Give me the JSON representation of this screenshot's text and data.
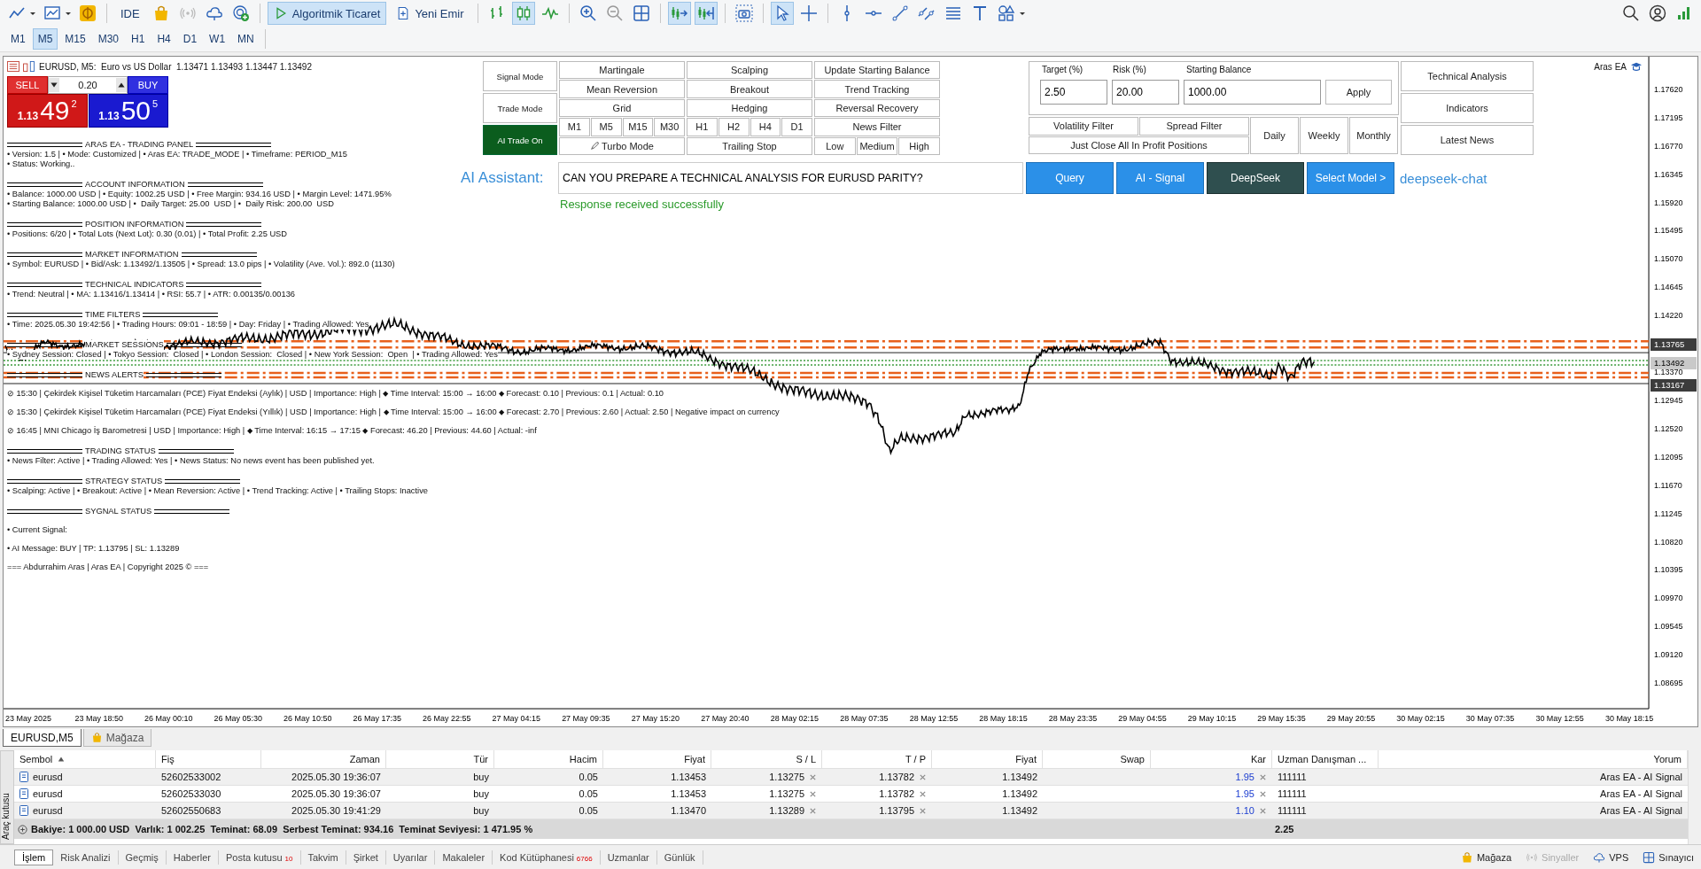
{
  "toolbar": {
    "ide": "IDE",
    "algo_trading": {
      "label": "Algoritmik Ticaret",
      "on": true
    },
    "new_order": "Yeni Emir",
    "signal": {
      "disabled": true
    },
    "chart_types": [
      {
        "selected": false
      },
      {
        "selected": true
      },
      {
        "selected": false
      }
    ],
    "zoom_out": {
      "disabled": true
    },
    "auto_scroll": {
      "on": true
    },
    "chart_shift": {
      "on": true
    },
    "tools": [
      {
        "selected": true
      },
      {
        "selected": false
      }
    ]
  },
  "timeframes": [
    {
      "label": "M1",
      "selected": false
    },
    {
      "label": "M5",
      "selected": true
    },
    {
      "label": "M15",
      "selected": false
    },
    {
      "label": "M30",
      "selected": false
    },
    {
      "label": "H1",
      "selected": false
    },
    {
      "label": "H4",
      "selected": false
    },
    {
      "label": "D1",
      "selected": false
    },
    {
      "label": "W1",
      "selected": false
    },
    {
      "label": "MN",
      "selected": false
    }
  ],
  "chart": {
    "title": "EURUSD, M5:  Euro vs US Dollar  1.13471 1.13493 1.13447 1.13492",
    "expert": "Aras EA",
    "one_click": {
      "sell": {
        "label": "SELL",
        "prefix": "1.13",
        "big": "49",
        "small": "2"
      },
      "lot": "0.20",
      "buy": {
        "label": "BUY",
        "prefix": "1.13",
        "big": "50",
        "small": "5"
      }
    },
    "price_axis": {
      "labels": [
        "1.17620",
        "1.17195",
        "1.16770",
        "1.16345",
        "1.15920",
        "1.15495",
        "1.15070",
        "1.14645",
        "1.14220",
        "1.13370",
        "1.12945",
        "1.12520",
        "1.12095",
        "1.11670",
        "1.11245",
        "1.10820",
        "1.10395",
        "1.09970",
        "1.09545",
        "1.09120",
        "1.08695"
      ],
      "tags": [
        {
          "text": "1.13765",
          "kind": "level"
        },
        {
          "text": "1.13492",
          "kind": "bid"
        },
        {
          "text": "1.13167",
          "kind": "level"
        }
      ]
    },
    "time_axis": [
      "23 May 2025",
      "23 May 18:50",
      "26 May 00:10",
      "26 May 05:30",
      "26 May 10:50",
      "26 May 17:35",
      "26 May 22:55",
      "27 May 04:15",
      "27 May 09:35",
      "27 May 15:20",
      "27 May 20:40",
      "28 May 02:15",
      "28 May 07:35",
      "28 May 12:55",
      "28 May 18:15",
      "28 May 23:35",
      "29 May 04:55",
      "29 May 10:15",
      "29 May 15:35",
      "29 May 20:55",
      "30 May 02:15",
      "30 May 07:35",
      "30 May 12:55",
      "30 May 18:15"
    ]
  },
  "info_panel": [
    {
      "title": "ARAS EA - TRADING PANEL",
      "kind": "normal",
      "lines": [
        "• Version: 1.5 | • Mode: Customized | • Aras EA: TRADE_MODE | • Timeframe: PERIOD_M15",
        "• Status: Working.."
      ]
    },
    {
      "title": "ACCOUNT INFORMATION",
      "kind": "normal",
      "lines": [
        "• Balance: 1000.00 USD | • Equity: 1002.25 USD | • Free Margin: 934.16 USD | • Margin Level: 1471.95%",
        "• Starting Balance: 1000.00 USD | •  Daily Target: 25.00  USD | •  Daily Risk: 200.00  USD"
      ]
    },
    {
      "title": "POSITION INFORMATION",
      "kind": "normal",
      "lines": [
        "• Positions: 6/20 | • Total Lots (Next Lot): 0.30 (0.01) | • Total Profit: 2.25 USD"
      ]
    },
    {
      "title": "MARKET INFORMATION",
      "kind": "normal",
      "lines": [
        "• Symbol: EURUSD | • Bid/Ask: 1.13492/1.13505 | • Spread: 13.0 pips | • Volatility (Ave. Vol.): 892.0 (1130)"
      ]
    },
    {
      "title": "TECHNICAL INDICATORS",
      "kind": "normal",
      "lines": [
        "• Trend: Neutral | • MA: 1.13416/1.13414 | • RSI: 55.7 | • ATR: 0.00135/0.00136"
      ]
    },
    {
      "title": "TIME FILTERS",
      "kind": "normal",
      "lines": [
        "• Time: 2025.05.30 19:42:56 | • Trading Hours: 09:01 - 18:59 | • Day: Friday | • Trading Allowed: Yes"
      ]
    },
    {
      "title": "MARKET SESSIONS",
      "kind": "normal",
      "lines": [
        "• Sydney Session: Closed | • Tokyo Session:  Closed | • London Session:  Closed | • New York Session:  Open  | • Trading Allowed: Yes"
      ]
    },
    {
      "title": "NEWS ALERTS",
      "kind": "spaced",
      "lines": [
        "⊘ 15:30 | Çekirdek Kişisel Tüketim Harcamaları (PCE) Fiyat Endeksi (Aylık) | USD | Importance: High | ⬥ Time Interval: 15:00 → 16:00 ⬥ Forecast: 0.10 | Previous: 0.1 | Actual: 0.10",
        "⊘ 15:30 | Çekirdek Kişisel Tüketim Harcamaları (PCE) Fiyat Endeksi (Yıllık) | USD | Importance: High | ⬥ Time Interval: 15:00 → 16:00 ⬥ Forecast: 2.70 | Previous: 2.60 | Actual: 2.50 | Negative impact on currency",
        "⊘ 16:45 | MNI Chicago İş Barometresi | USD | Importance: High | ⬥ Time Interval: 16:15 → 17:15 ⬥ Forecast: 46.20 | Previous: 44.60 | Actual: -inf"
      ]
    },
    {
      "title": "TRADING STATUS",
      "kind": "normal",
      "lines": [
        "• News Filter: Active | • Trading Allowed: Yes | • News Status: No news event has been published yet."
      ]
    },
    {
      "title": "STRATEGY STATUS",
      "kind": "normal",
      "lines": [
        "• Scalping: Active | • Breakout: Active | • Mean Reversion: Active | • Trend Tracking: Active | • Trailing Stops: Inactive"
      ]
    },
    {
      "title": "SYGNAL STATUS",
      "kind": "spaced",
      "lines": [
        "• Current Signal:",
        "• AI Message: BUY | TP: 1.13795 | SL: 1.13289",
        "=== Abdurrahim Aras | Aras EA | Copyright 2025 © ==="
      ]
    }
  ],
  "ea_panel": {
    "modes": [
      {
        "label": "Signal Mode",
        "on": false
      },
      {
        "label": "Trade Mode",
        "on": false
      },
      {
        "label": "AI Trade On",
        "on": true
      }
    ],
    "columns": [
      {
        "rows": [
          [
            "Martingale"
          ],
          [
            "Mean Reversion"
          ],
          [
            "Grid"
          ],
          [
            "M1",
            "M5",
            "M15",
            "M30"
          ],
          [
            "Turbo Mode"
          ]
        ]
      },
      {
        "rows": [
          [
            "Scalping"
          ],
          [
            "Breakout"
          ],
          [
            "Hedging"
          ],
          [
            "H1",
            "H2",
            "H4",
            "D1"
          ],
          [
            "Trailing Stop"
          ]
        ]
      },
      {
        "rows": [
          [
            "Update Starting Balance"
          ],
          [
            "Trend Tracking"
          ],
          [
            "Reversal Recovery"
          ],
          [
            "News Filter"
          ],
          [
            "Low",
            "Medium",
            "High"
          ]
        ]
      }
    ],
    "settings": {
      "labels": [
        "Target (%)",
        "Risk (%)",
        "Starting Balance"
      ],
      "values": [
        "2.50",
        "20.00",
        "1000.00"
      ],
      "apply": "Apply"
    },
    "filters": [
      "Volatility Filter",
      "Spread Filter"
    ],
    "close_all": "Just Close All In Profit Positions",
    "periods": [
      "Daily",
      "Weekly",
      "Monthly"
    ],
    "side": [
      "Technical Analysis",
      "Indicators",
      "Latest News"
    ],
    "assistant": {
      "label": "AI Assistant:",
      "query": "CAN YOU PREPARE A TECHNICAL ANALYSIS FOR EURUSD PARITY?",
      "buttons": [
        {
          "label": "Query",
          "kind": "primary"
        },
        {
          "label": "AI - Signal",
          "kind": "primary"
        },
        {
          "label": "DeepSeek",
          "kind": "dark"
        },
        {
          "label": "Select Model >",
          "kind": "primary"
        }
      ],
      "model": "deepseek-chat",
      "status": "Response received successfully"
    }
  },
  "chart_tabs": [
    {
      "label": "EURUSD,M5",
      "selected": true
    },
    {
      "label": "Mağaza",
      "selected": false
    }
  ],
  "toolbox_label": "Araç kutusu",
  "trade_table": {
    "columns": [
      {
        "label": "Sembol",
        "sorted": true
      },
      {
        "label": "Fiş",
        "sorted": false
      },
      {
        "label": "Zaman",
        "sorted": false
      },
      {
        "label": "Tür",
        "sorted": false
      },
      {
        "label": "Hacim",
        "sorted": false
      },
      {
        "label": "Fiyat",
        "sorted": false
      },
      {
        "label": "S / L",
        "sorted": false
      },
      {
        "label": "T / P",
        "sorted": false
      },
      {
        "label": "Fiyat",
        "sorted": false
      },
      {
        "label": "Swap",
        "sorted": false
      },
      {
        "label": "Kar",
        "sorted": false
      },
      {
        "label": "Uzman Danışman ...",
        "sorted": false
      },
      {
        "label": "Yorum",
        "sorted": false
      }
    ],
    "rows": [
      {
        "cells": [
          "eurusd",
          "52602533002",
          "2025.05.30 19:36:07",
          "buy",
          "0.05",
          "1.13453",
          "1.13275",
          "1.13782",
          "1.13492",
          "",
          "1.95",
          "111111",
          "Aras EA - AI Signal"
        ]
      },
      {
        "cells": [
          "eurusd",
          "52602533030",
          "2025.05.30 19:36:07",
          "buy",
          "0.05",
          "1.13453",
          "1.13275",
          "1.13782",
          "1.13492",
          "",
          "1.95",
          "111111",
          "Aras EA - AI Signal"
        ]
      },
      {
        "cells": [
          "eurusd",
          "52602550683",
          "2025.05.30 19:41:29",
          "buy",
          "0.05",
          "1.13470",
          "1.13289",
          "1.13795",
          "1.13492",
          "",
          "1.10",
          "111111",
          "Aras EA - AI Signal"
        ]
      }
    ],
    "summary": {
      "text": "Bakiye: 1 000.00 USD  Varlık: 1 002.25  Teminat: 68.09  Serbest Teminat: 934.16  Teminat Seviyesi: 1 471.95 %",
      "profit": "2.25"
    }
  },
  "bottom_tabs": [
    {
      "label": "İşlem",
      "selected": true
    },
    {
      "label": "Risk Analizi",
      "selected": false
    },
    {
      "label": "Geçmiş",
      "selected": false
    },
    {
      "label": "Haberler",
      "selected": false
    },
    {
      "label": "Posta kutusu",
      "badge": "10",
      "selected": false
    },
    {
      "label": "Takvim",
      "selected": false
    },
    {
      "label": "Şirket",
      "selected": false
    },
    {
      "label": "Uyarılar",
      "selected": false
    },
    {
      "label": "Makaleler",
      "selected": false
    },
    {
      "label": "Kod Kütüphanesi",
      "badge": "6766",
      "selected": false
    },
    {
      "label": "Uzmanlar",
      "selected": false
    },
    {
      "label": "Günlük",
      "selected": false
    }
  ],
  "status_links": [
    {
      "label": "Mağaza",
      "disabled": false
    },
    {
      "label": "Sinyaller",
      "disabled": true
    },
    {
      "label": "VPS",
      "disabled": false
    },
    {
      "label": "Sınayıcı",
      "disabled": false
    }
  ]
}
